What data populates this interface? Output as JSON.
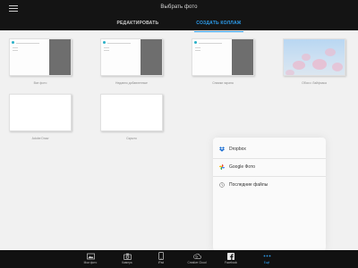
{
  "header": {
    "title": "Выбрать фото",
    "tabs": [
      {
        "label": "РЕДАКТИРОВАТЬ",
        "active": false
      },
      {
        "label": "СОЗДАТЬ КОЛЛАЖ",
        "active": true
      }
    ]
  },
  "albums": [
    {
      "label": "Все фото",
      "type": "screenshot"
    },
    {
      "label": "Недавно добавленные",
      "type": "screenshot"
    },
    {
      "label": "Снимки экрана",
      "type": "screenshot"
    },
    {
      "label": "Обои с Лайфхака",
      "type": "flowers"
    },
    {
      "label": "Adobe Draw",
      "type": "empty"
    },
    {
      "label": "Скрыто",
      "type": "empty"
    }
  ],
  "popover": {
    "items": [
      {
        "label": "Dropbox",
        "icon": "dropbox-icon"
      },
      {
        "label": "Google Фото",
        "icon": "google-photos-icon"
      },
      {
        "label": "Последние файлы",
        "icon": "clock-icon"
      }
    ]
  },
  "toolbar": {
    "items": [
      {
        "label": "Мои фото",
        "icon": "photos-icon",
        "active": false
      },
      {
        "label": "Камера",
        "icon": "camera-icon",
        "active": false
      },
      {
        "label": "iPad",
        "icon": "ipad-icon",
        "active": false
      },
      {
        "label": "Creative Cloud",
        "icon": "creative-cloud-icon",
        "active": false
      },
      {
        "label": "Facebook",
        "icon": "facebook-icon",
        "active": false
      },
      {
        "label": "Ещё",
        "icon": "more-icon",
        "active": true
      }
    ]
  },
  "colors": {
    "accent": "#2d9ff0",
    "header_bg": "#141414",
    "content_bg": "#f1f1f1"
  }
}
